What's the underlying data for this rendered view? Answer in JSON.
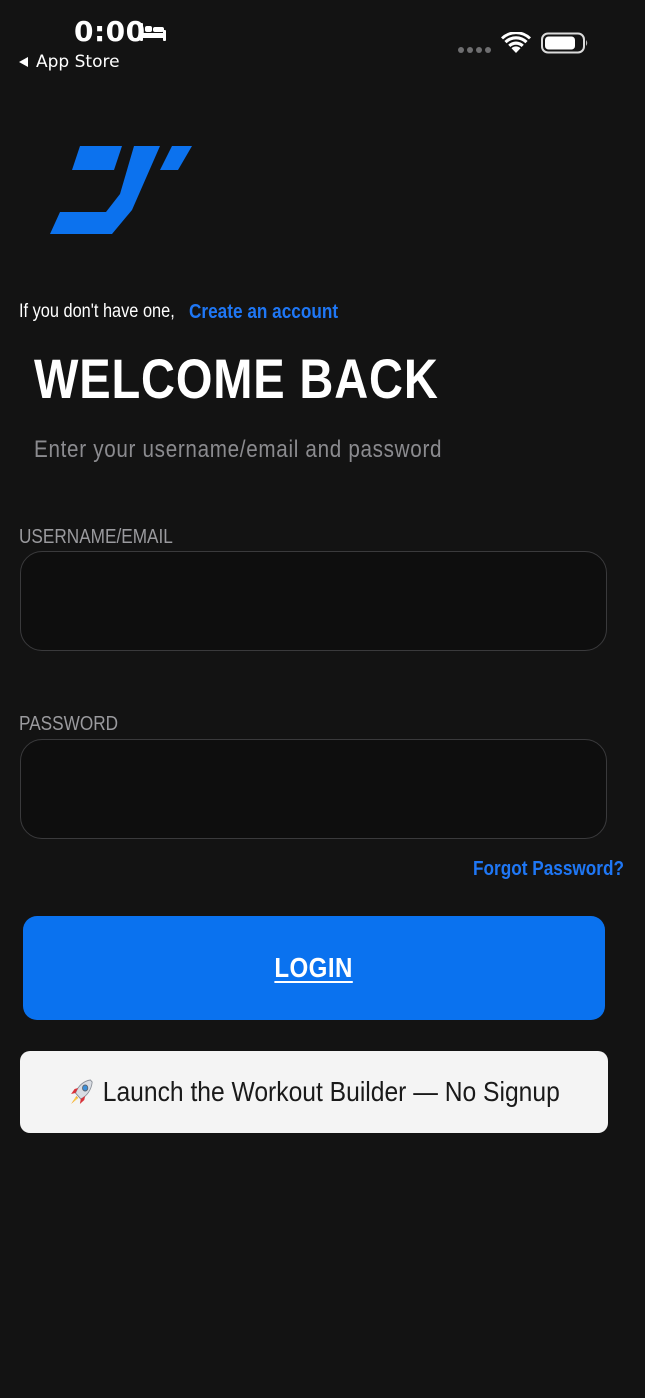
{
  "status_bar": {
    "time": "0:00",
    "back_label": "App Store",
    "icons": [
      "bed-icon",
      "signal-dots-icon",
      "wifi-icon",
      "battery-icon"
    ]
  },
  "colors": {
    "background": "#131313",
    "accent": "#0a72ef",
    "link": "#1f77f5",
    "muted_text": "#8b8b8f",
    "secondary_button_bg": "#f4f4f4"
  },
  "header": {
    "logo_icon": "brand-logo-icon",
    "account_hint": "If you don't have one,",
    "create_account_link": "Create an account",
    "title": "WELCOME BACK",
    "subtitle": "Enter your username/email and password"
  },
  "form": {
    "username_label": "USERNAME/EMAIL",
    "username_value": "",
    "password_label": "PASSWORD",
    "password_value": "",
    "forgot_password_link": "Forgot Password?",
    "login_button": "LOGIN"
  },
  "secondary_action": {
    "icon": "rocket-icon",
    "label": "Launch the Workout Builder — No Signup"
  }
}
